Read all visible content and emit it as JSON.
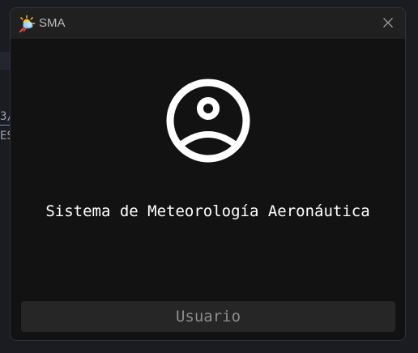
{
  "window": {
    "title": "SMA",
    "app_icon": "weather-sun-cloud-icon",
    "close_icon": "close-icon"
  },
  "main": {
    "user_icon": "user-circle-icon",
    "system_name": "Sistema de Meteorología Aeronáutica",
    "user_button_label": "Usuario"
  },
  "background": {
    "line1": "3/",
    "line2": "ES"
  },
  "colors": {
    "window_bg": "#121212",
    "titlebar_bg": "#202020",
    "button_bg": "#262626",
    "text_primary": "#ffffff",
    "text_muted": "#8d8d8d"
  }
}
